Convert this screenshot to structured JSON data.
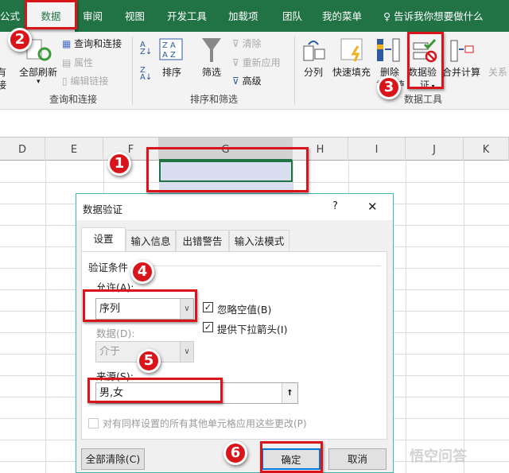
{
  "menu_tabs": [
    "公式",
    "数据",
    "审阅",
    "视图",
    "开发工具",
    "加载项",
    "团队",
    "我的菜单"
  ],
  "tell_me": "告诉我你想要做什么",
  "ribbon": {
    "query_group": {
      "refresh_all": "全部刷新",
      "query_connect": "查询和连接",
      "properties": "属性",
      "edit_links": "编辑链接",
      "label": "查询和连接",
      "partial_left": "有",
      "partial_left2": "接"
    },
    "sort_group": {
      "sort": "排序",
      "filter": "筛选",
      "clear": "清除",
      "reapply": "重新应用",
      "advanced": "高级",
      "label": "排序和筛选"
    },
    "tools_group": {
      "text_to_columns": "分列",
      "flash_fill": "快速填充",
      "remove_dup": "删除",
      "remove_dup2": "重复值",
      "data_validation": "数据验",
      "data_validation2": "证",
      "consolidate": "合并计算",
      "relationships": "关系",
      "label": "数据工具"
    }
  },
  "columns": [
    "D",
    "E",
    "F",
    "G",
    "H",
    "I",
    "J",
    "K"
  ],
  "steps": [
    "1",
    "2",
    "3",
    "4",
    "5",
    "6"
  ],
  "dialog": {
    "title": "数据验证",
    "help": "?",
    "close": "✕",
    "tabs": [
      "设置",
      "输入信息",
      "出错警告",
      "输入法模式"
    ],
    "section": "验证条件",
    "allow_label": "允许(A):",
    "allow_value": "序列",
    "ignore_blank": "忽略空值(B)",
    "ignore_blank_checked": true,
    "dropdown": "提供下拉箭头(I)",
    "dropdown_checked": true,
    "data_label": "数据(D):",
    "data_value": "介于",
    "source_label": "来源(S):",
    "source_value": "男,女",
    "apply_all": "对有同样设置的所有其他单元格应用这些更改(P)",
    "apply_all_checked": false,
    "clear_all": "全部清除(C)",
    "ok": "确定",
    "cancel": "取消"
  },
  "watermark": "悟空问答"
}
